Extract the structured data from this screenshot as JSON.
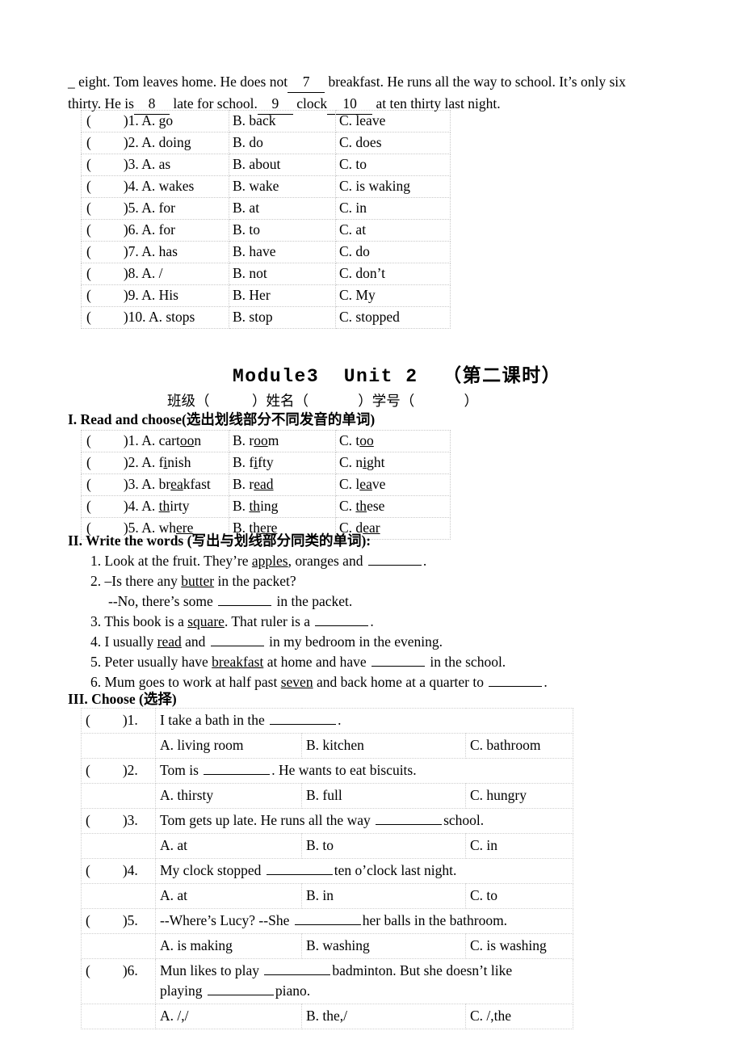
{
  "top_passage": {
    "line1_pre": "_ eight. Tom leaves home. He does not",
    "blank7": "7",
    "line1_mid": "breakfast. He runs all the way to school. It’s only six",
    "line2_pre": "thirty. He is",
    "blank8": "8",
    "line2_mid": "late for school.",
    "blank9": "9",
    "line2_mid2": "clock",
    "blank10": "10",
    "line2_end": "at ten thirty last night."
  },
  "cloze_table": {
    "rows": [
      {
        "paren": "(",
        "close": ")",
        "num": "1.",
        "a": "A. go",
        "b": "B. back",
        "c": "C. leave"
      },
      {
        "paren": "(",
        "close": ")",
        "num": "2.",
        "a": "A. doing",
        "b": "B. do",
        "c": "C. does"
      },
      {
        "paren": "(",
        "close": ")",
        "num": "3.",
        "a": "A. as",
        "b": "B. about",
        "c": "C. to"
      },
      {
        "paren": "(",
        "close": ")",
        "num": "4.",
        "a": "A. wakes",
        "b": "B. wake",
        "c": "C. is waking"
      },
      {
        "paren": "(",
        "close": ")",
        "num": "5.",
        "a": "A. for",
        "b": "B. at",
        "c": "C. in"
      },
      {
        "paren": "(",
        "close": ")",
        "num": "6.",
        "a": "A. for",
        "b": "B. to",
        "c": "C. at"
      },
      {
        "paren": "(",
        "close": ")",
        "num": "7.",
        "a": "A. has",
        "b": "B. have",
        "c": "C. do"
      },
      {
        "paren": "(",
        "close": ")",
        "num": "8.",
        "a": "A. /",
        "b": "B. not",
        "c": "C. don’t"
      },
      {
        "paren": "(",
        "close": ")",
        "num": "9.",
        "a": "A. His",
        "b": "B. Her",
        "c": "C. My"
      },
      {
        "paren": "(",
        "close": ")",
        "num": "10.",
        "a": "A. stops",
        "b": "B. stop",
        "c": "C. stopped"
      }
    ]
  },
  "worksheet_title": "Module3  Unit 2  （第二课时）",
  "info_line": "班级（            ）姓名（              ）学号（              ）",
  "section1": {
    "heading": "I. Read and choose(选出划线部分不同发音的单词)",
    "rows": [
      {
        "num": "1.",
        "a": [
          "A. cart",
          "oo",
          "n"
        ],
        "b": [
          "B. r",
          "oo",
          "m"
        ],
        "c": [
          "C. t",
          "oo",
          ""
        ]
      },
      {
        "num": "2.",
        "a": [
          "A. f",
          "i",
          "nish"
        ],
        "b": [
          "B. f",
          "i",
          "fty"
        ],
        "c": [
          "C. n",
          "i",
          "ght"
        ]
      },
      {
        "num": "3.",
        "a": [
          "A. br",
          "ea",
          "kfast"
        ],
        "b": [
          "B. r",
          "ead",
          ""
        ],
        "c": [
          "C. l",
          "ea",
          "ve"
        ]
      },
      {
        "num": "4.",
        "a": [
          "A. ",
          "th",
          "irty"
        ],
        "b": [
          "B. ",
          "th",
          "ing"
        ],
        "c": [
          "C. ",
          "th",
          "ese"
        ]
      },
      {
        "num": "5.",
        "a": [
          "A. wh",
          "ere",
          ""
        ],
        "b": [
          "B. th",
          "ere",
          ""
        ],
        "c": [
          "C. d",
          "ear",
          ""
        ]
      }
    ]
  },
  "section2": {
    "heading": "II. Write the words (写出与划线部分同类的单词):",
    "items": [
      {
        "num": "1.",
        "pre": "Look at the fruit. They’re ",
        "ul": "apples",
        "mid": ", oranges and ",
        "blank": true,
        "post": "."
      },
      {
        "num": "2.",
        "pre": "–Is there any ",
        "ul": "butter",
        "mid": " in the packet?",
        "blank": false,
        "post": ""
      },
      {
        "num": "",
        "pre": "--No, there’s some ",
        "ul": "",
        "mid": "",
        "blank": true,
        "post": " in the packet."
      },
      {
        "num": "3.",
        "pre": "This book is a ",
        "ul": "square",
        "mid": ". That ruler is a ",
        "blank": true,
        "post": "."
      },
      {
        "num": "4.",
        "pre": "I usually ",
        "ul": "read",
        "mid": " and ",
        "blank": true,
        "post": " in my bedroom in the evening."
      },
      {
        "num": "5.",
        "pre": "Peter usually have ",
        "ul": "breakfast",
        "mid": " at home and have ",
        "blank": true,
        "post": " in the school."
      },
      {
        "num": "6.",
        "pre": "Mum goes to work at half past ",
        "ul": "seven",
        "mid": " and back home at a quarter to ",
        "blank": true,
        "post": "."
      }
    ]
  },
  "section3": {
    "heading": "III. Choose (选择)",
    "questions": [
      {
        "paren": "(",
        "close": ")",
        "num": "1.",
        "stem_pre": "I take a bath in the ",
        "stem_post": ".",
        "stem_pre2": "",
        "stem_post2": "",
        "a": "A. living room",
        "b": "B. kitchen",
        "c": "C. bathroom"
      },
      {
        "paren": "(",
        "close": ")",
        "num": "2.",
        "stem_pre": "Tom is ",
        "stem_post": ". He wants to eat biscuits.",
        "stem_pre2": "",
        "stem_post2": "",
        "a": "A. thirsty",
        "b": "B. full",
        "c": "C. hungry"
      },
      {
        "paren": "(",
        "close": ")",
        "num": "3.",
        "stem_pre": "Tom gets up late. He runs all the way ",
        "stem_post": "school.",
        "stem_pre2": "",
        "stem_post2": "",
        "a": "A. at",
        "b": "B. to",
        "c": "C. in"
      },
      {
        "paren": "(",
        "close": ")",
        "num": "4.",
        "stem_pre": "My clock stopped ",
        "stem_post": "ten o’clock last night.",
        "stem_pre2": "",
        "stem_post2": "",
        "a": "A. at",
        "b": "B. in",
        "c": "C. to"
      },
      {
        "paren": "(",
        "close": ")",
        "num": "5.",
        "stem_pre": "--Where’s Lucy? --She ",
        "stem_post": "her balls in the bathroom.",
        "stem_pre2": "",
        "stem_post2": "",
        "a": "A. is making",
        "b": "B. washing",
        "c": "C. is washing"
      },
      {
        "paren": "(",
        "close": ")",
        "num": "6.",
        "stem_pre": "Mun likes to play ",
        "stem_post": "badminton. But she doesn’t like",
        "stem_pre2": "playing ",
        "stem_post2": "piano.",
        "a": "A. /,/",
        "b": "B. the,/",
        "c": "C. /,the"
      }
    ]
  }
}
